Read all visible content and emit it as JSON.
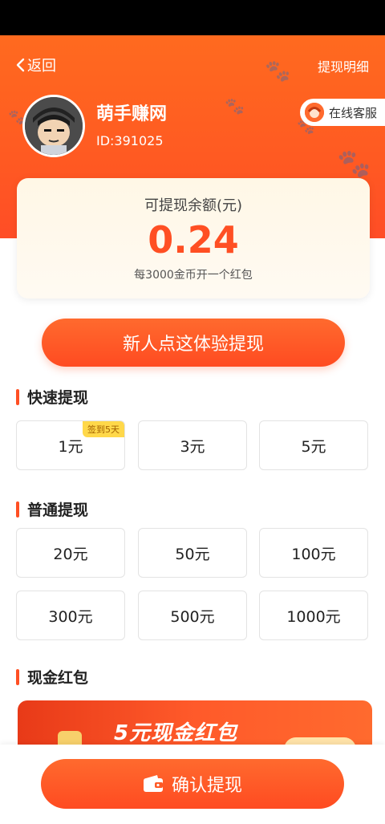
{
  "header": {
    "back_label": "返回",
    "detail_label": "提现明细",
    "username": "萌手赚网",
    "user_id": "ID:391025",
    "service_label": "在线客服"
  },
  "balance": {
    "label": "可提现余额(元)",
    "amount": "0.24",
    "note": "每3000金币开一个红包"
  },
  "newbie_button": "新人点这体验提现",
  "quick": {
    "title": "快速提现",
    "options": [
      {
        "label": "1元",
        "tag": "签到5天"
      },
      {
        "label": "3元"
      },
      {
        "label": "5元"
      }
    ]
  },
  "normal": {
    "title": "普通提现",
    "options": [
      {
        "label": "20元"
      },
      {
        "label": "50元"
      },
      {
        "label": "100元"
      },
      {
        "label": "300元"
      },
      {
        "label": "500元"
      },
      {
        "label": "1000元"
      }
    ]
  },
  "cash": {
    "title": "现金红包",
    "banner_text": "5元现金红包"
  },
  "confirm_button": "确认提现",
  "colors": {
    "accent": "#ff4f23",
    "header": "#ff6a1f",
    "tag": "#ffd84a"
  }
}
